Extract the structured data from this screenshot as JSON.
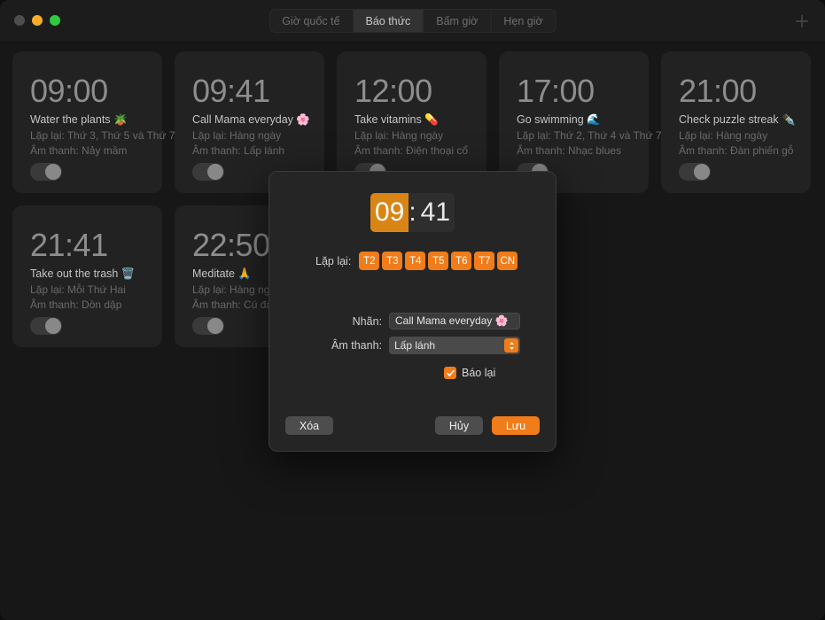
{
  "window": {
    "traffic_lights": [
      "close",
      "minimize",
      "maximize"
    ],
    "colors": {
      "accent": "#f07c1a",
      "accent_dim": "#d98516",
      "window_bg": "#171717",
      "card_bg": "#222222",
      "modal_bg": "#252525"
    }
  },
  "titlebar": {
    "tabs": [
      {
        "label": "Giờ quốc tế",
        "active": false
      },
      {
        "label": "Báo thức",
        "active": true
      },
      {
        "label": "Bấm giờ",
        "active": false
      },
      {
        "label": "Hẹn giờ",
        "active": false
      }
    ],
    "add_button": "add-icon"
  },
  "alarms": [
    {
      "time": "09:00",
      "label": "Water the plants 🪴",
      "repeat": "Lặp lại: Thứ 3, Thứ 5 và Thứ 7",
      "sound": "Âm thanh: Nảy mầm",
      "enabled": true
    },
    {
      "time": "09:41",
      "label": "Call Mama everyday 🌸",
      "repeat": "Lặp lại: Hàng ngày",
      "sound": "Âm thanh: Lấp lánh",
      "enabled": true
    },
    {
      "time": "12:00",
      "label": "Take vitamins 💊",
      "repeat": "Lặp lại: Hàng ngày",
      "sound": "Âm thanh: Điện thoại cổ",
      "enabled": true
    },
    {
      "time": "17:00",
      "label": "Go swimming 🌊",
      "repeat": "Lặp lại: Thứ 2, Thứ 4 và Thứ 7",
      "sound": "Âm thanh: Nhạc blues",
      "enabled": true
    },
    {
      "time": "21:00",
      "label": "Check puzzle streak ✒️",
      "repeat": "Lặp lại: Hàng ngày",
      "sound": "Âm thanh: Đàn phiến gỗ",
      "enabled": true
    },
    {
      "time": "21:41",
      "label": "Take out the trash 🗑️",
      "repeat": "Lặp lại: Mỗi Thứ Hai",
      "sound": "Âm thanh: Dồn dập",
      "enabled": true
    },
    {
      "time": "22:50",
      "label": "Meditate 🙏",
      "repeat": "Lặp lại: Hàng ngày",
      "sound": "Âm thanh: Cú đánh",
      "enabled": true
    }
  ],
  "modal": {
    "time": {
      "hour": "09",
      "separator": ":",
      "minute": "41",
      "selected_field": "hour"
    },
    "repeat": {
      "label": "Lặp lại:",
      "days": [
        {
          "code": "T2",
          "selected": true
        },
        {
          "code": "T3",
          "selected": true
        },
        {
          "code": "T4",
          "selected": true
        },
        {
          "code": "T5",
          "selected": true
        },
        {
          "code": "T6",
          "selected": true
        },
        {
          "code": "T7",
          "selected": true
        },
        {
          "code": "CN",
          "selected": true
        }
      ]
    },
    "name_field": {
      "label": "Nhãn:",
      "value": "Call Mama everyday 🌸"
    },
    "sound_field": {
      "label": "Âm thanh:",
      "value": "Lấp lánh"
    },
    "snooze": {
      "label": "Báo lại",
      "checked": true
    },
    "buttons": {
      "delete": "Xóa",
      "cancel": "Hủy",
      "save": "Lưu"
    }
  }
}
